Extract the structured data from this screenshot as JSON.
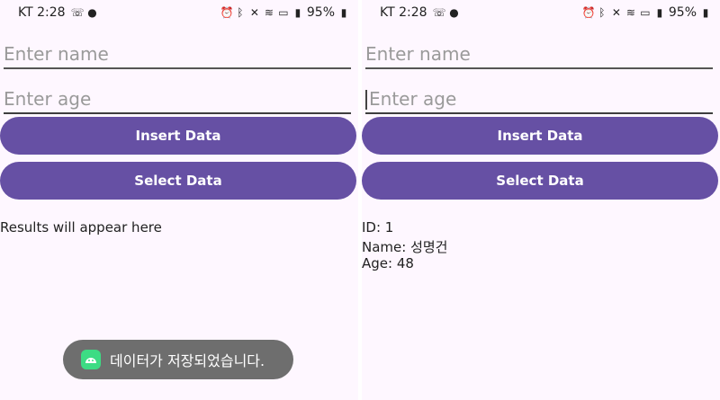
{
  "left": {
    "status": {
      "carrier_time": "KT 2:28",
      "battery": "95%"
    },
    "fields": {
      "name_placeholder": "Enter name",
      "age_placeholder": "Enter age"
    },
    "buttons": {
      "insert": "Insert Data",
      "select": "Select Data"
    },
    "results": {
      "text": "Results will appear here"
    },
    "toast": {
      "text": "데이터가 저장되었습니다."
    }
  },
  "right": {
    "status": {
      "carrier_time": "KT 2:28",
      "battery": "95%"
    },
    "fields": {
      "name_placeholder": "Enter name",
      "age_placeholder": "Enter age"
    },
    "buttons": {
      "insert": "Insert Data",
      "select": "Select Data"
    },
    "results": {
      "id": "ID: 1",
      "name": "Name: 성명건",
      "age": "Age: 48"
    }
  },
  "colors": {
    "background": "#fef7ff",
    "button": "#6650a4",
    "toast": "#6e6e6e",
    "android_icon": "#3ddc84"
  },
  "icons": [
    "alarm-icon",
    "bluetooth-icon",
    "mute-icon",
    "wifi-icon",
    "hd-icon",
    "signal-icon",
    "battery-icon",
    "call-forward-icon",
    "chat-icon",
    "android-icon"
  ]
}
